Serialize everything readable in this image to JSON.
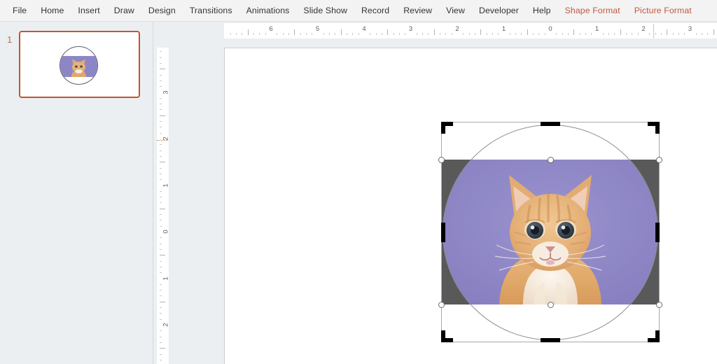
{
  "app": {
    "name": "PowerPoint",
    "mode": "crop"
  },
  "ribbon": {
    "tabs": [
      {
        "label": "File",
        "contextual": false
      },
      {
        "label": "Home",
        "contextual": false
      },
      {
        "label": "Insert",
        "contextual": false
      },
      {
        "label": "Draw",
        "contextual": false
      },
      {
        "label": "Design",
        "contextual": false
      },
      {
        "label": "Transitions",
        "contextual": false
      },
      {
        "label": "Animations",
        "contextual": false
      },
      {
        "label": "Slide Show",
        "contextual": false
      },
      {
        "label": "Record",
        "contextual": false
      },
      {
        "label": "Review",
        "contextual": false
      },
      {
        "label": "View",
        "contextual": false
      },
      {
        "label": "Developer",
        "contextual": false
      },
      {
        "label": "Help",
        "contextual": false
      },
      {
        "label": "Shape Format",
        "contextual": true
      },
      {
        "label": "Picture Format",
        "contextual": true
      }
    ],
    "contextual_color": "#c05a3e",
    "text_color": "#333333",
    "background": "#f3f3f3"
  },
  "thumbnail_panel": {
    "background": "#eceff1",
    "slides": [
      {
        "number": "1",
        "selected": true,
        "border_color": "#c1562f",
        "number_color": "#b4714f",
        "content": "oval-cropped-kitten-picture"
      }
    ]
  },
  "rulers": {
    "horizontal": {
      "unit": "inches",
      "labels": [
        "6",
        "5",
        "4",
        "3",
        "2",
        "1",
        "0",
        "1",
        "2",
        "3"
      ],
      "marker_position_label": "2",
      "marker_color": "#d07b4e",
      "background": "#ffffff"
    },
    "vertical": {
      "unit": "inches",
      "labels": [
        "3",
        "2",
        "1",
        "0",
        "1",
        "2"
      ],
      "marker_position_label": "2",
      "marker_color": "#d07b4e",
      "background": "#ffffff"
    }
  },
  "slide": {
    "background": "#ffffff",
    "objects": [
      {
        "type": "picture",
        "name": "kitten-picture",
        "shape": "oval",
        "selected": true,
        "crop_mode": true,
        "photo_background_color": "#8d86c6",
        "crop_overlay_color": "#595959",
        "outline_color": "#8a8d90",
        "subject": "orange tabby kitten on purple background",
        "sizing_handles": [
          "top-left",
          "top-center",
          "top-right",
          "middle-left",
          "middle-right",
          "bottom-left",
          "bottom-center",
          "bottom-right"
        ],
        "crop_handles": [
          "crop-top-left",
          "crop-top-center",
          "crop-top-right",
          "crop-middle-left",
          "crop-middle-right",
          "crop-bottom-left",
          "crop-bottom-center",
          "crop-bottom-right"
        ]
      }
    ]
  }
}
